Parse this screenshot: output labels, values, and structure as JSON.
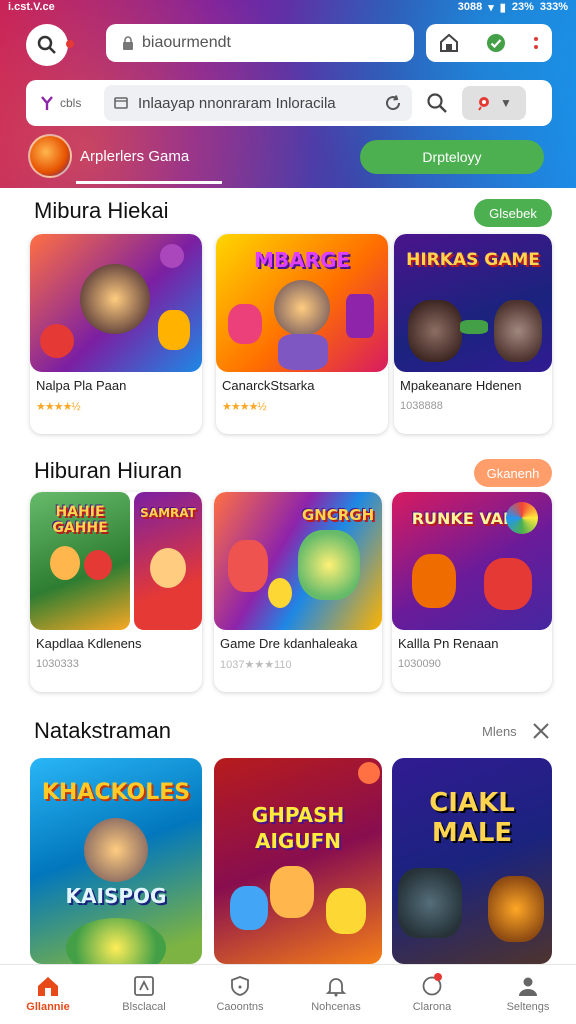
{
  "status": {
    "left": "i.cst.V.ce",
    "right1": "3088",
    "right2": "23%",
    "right3": "333%"
  },
  "topbar": {
    "url": "biaourmendt"
  },
  "searchrow": {
    "tag": "cbls",
    "query": "Inlaayap nnonraram Inloracila"
  },
  "category": {
    "label": "Arplerlers Gama",
    "button": "Drpteloyy"
  },
  "section1": {
    "title": "Mibura Hiekai",
    "action": "Glsebek",
    "cards": [
      {
        "name": "Nalpa Pla Paan",
        "meta": "★★★★½"
      },
      {
        "name": "CanarckStsarka",
        "meta": "★★★★½"
      },
      {
        "name": "Mpakeanare Hdenen",
        "meta": "1038888"
      }
    ],
    "art": [
      "",
      "MBARGE",
      "HIRKAS GAME"
    ]
  },
  "section2": {
    "title": "Hiburan Hiuran",
    "action": "Gkanenh",
    "cards": [
      {
        "name": "Kapdlaa Kdlenens",
        "meta": "1030333"
      },
      {
        "name": "Game Dre kdanhaleaka",
        "meta": "1037★★★110"
      },
      {
        "name": "Kallla Pn Renaan",
        "meta": "1030090"
      }
    ],
    "art": [
      "HAHIE GAHHE",
      "SAMRAT",
      "GNCRGH",
      "RUNKE VAKIE"
    ]
  },
  "section3": {
    "title": "Natakstraman",
    "more": "Mlens",
    "art": [
      "KHACKOLES",
      "GHPASH AIGUFN",
      "CIAKL MALE"
    ],
    "subtitle": "KAISPOG"
  },
  "nav": [
    {
      "label": "Gllannie"
    },
    {
      "label": "Blsclacal"
    },
    {
      "label": "Caoontns"
    },
    {
      "label": "Nohcenas"
    },
    {
      "label": "Clarona"
    },
    {
      "label": "Seltengs"
    }
  ],
  "colors": {
    "accent": "#e64a19",
    "green": "#4caf50",
    "orange": "#ff9e6b"
  }
}
